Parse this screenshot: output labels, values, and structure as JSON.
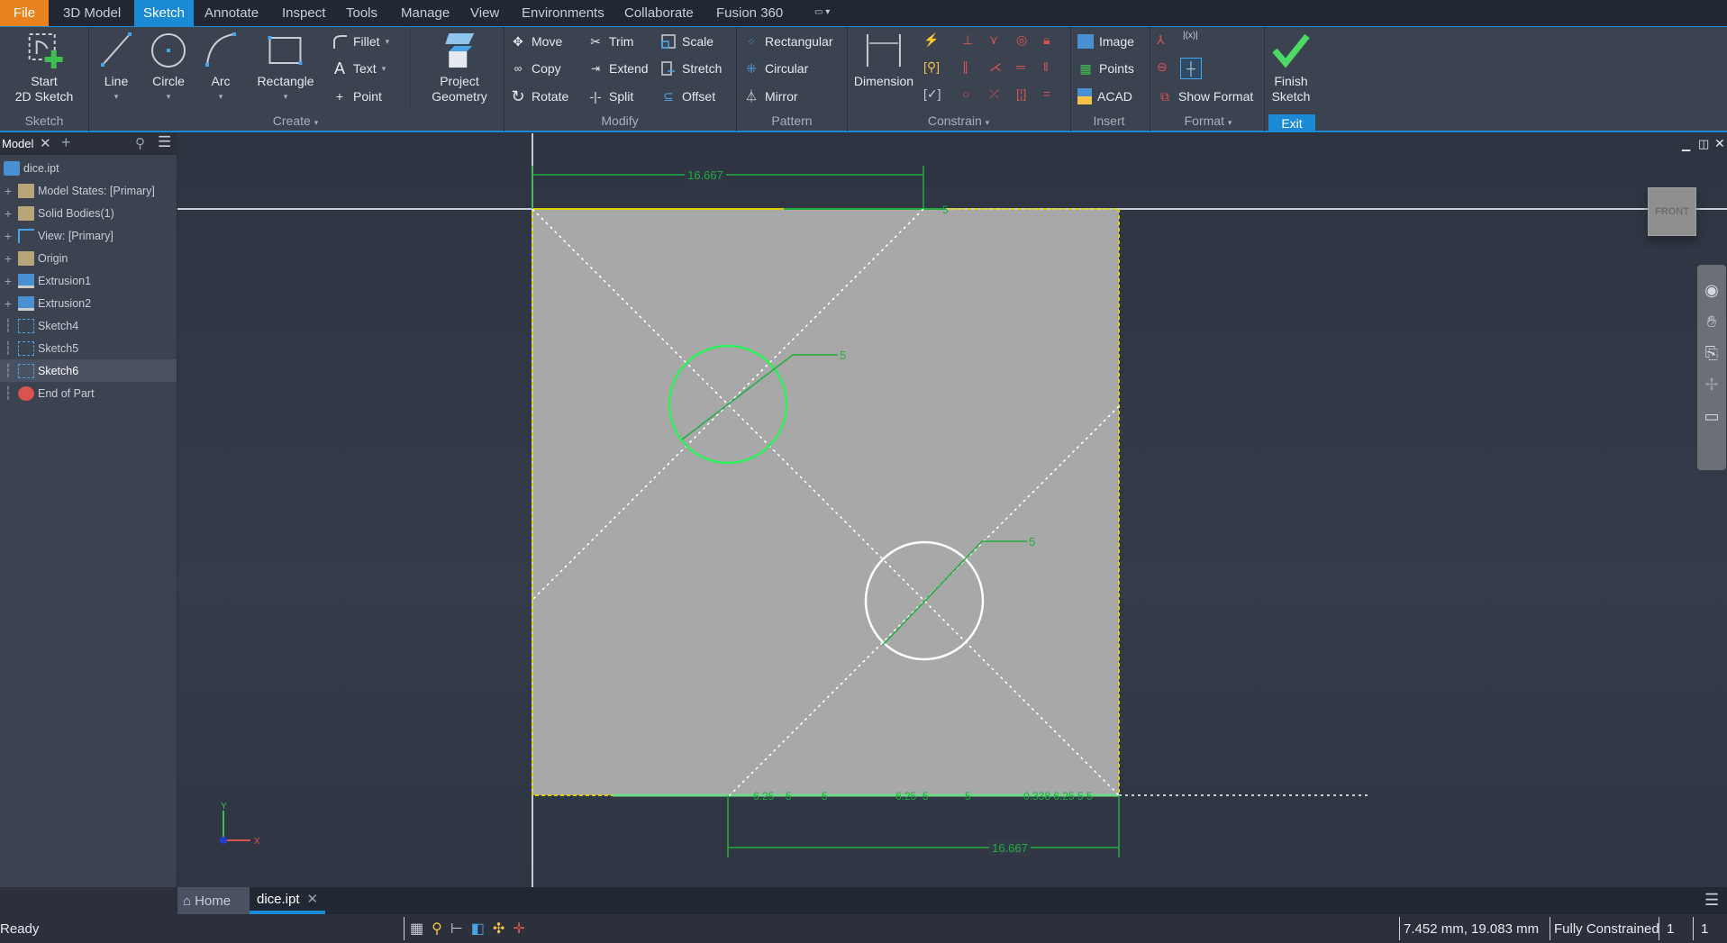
{
  "menu": {
    "tabs": [
      "File",
      "3D Model",
      "Sketch",
      "Annotate",
      "Inspect",
      "Tools",
      "Manage",
      "View",
      "Environments",
      "Collaborate",
      "Fusion 360"
    ],
    "active": "Sketch"
  },
  "ribbon": {
    "sketch_panel": {
      "start_label_1": "Start",
      "start_label_2": "2D Sketch",
      "label": "Sketch"
    },
    "create_panel": {
      "line": "Line",
      "circle": "Circle",
      "arc": "Arc",
      "rectangle": "Rectangle",
      "fillet": "Fillet",
      "text": "Text",
      "point": "Point",
      "project_1": "Project",
      "project_2": "Geometry",
      "label": "Create"
    },
    "modify_panel": {
      "move": "Move",
      "copy": "Copy",
      "rotate": "Rotate",
      "trim": "Trim",
      "extend": "Extend",
      "split": "Split",
      "scale": "Scale",
      "stretch": "Stretch",
      "offset": "Offset",
      "label": "Modify"
    },
    "pattern_panel": {
      "rectangular": "Rectangular",
      "circular": "Circular",
      "mirror": "Mirror",
      "label": "Pattern"
    },
    "constrain_panel": {
      "dimension": "Dimension",
      "label": "Constrain"
    },
    "insert_panel": {
      "image": "Image",
      "points": "Points",
      "acad": "ACAD",
      "label": "Insert"
    },
    "format_panel": {
      "show_format": "Show Format",
      "label": "Format"
    },
    "exit_panel": {
      "finish_1": "Finish",
      "finish_2": "Sketch",
      "label": "Exit"
    }
  },
  "browser": {
    "tab": "Model",
    "items": [
      {
        "label": "dice.ipt",
        "icon": "part-icon"
      },
      {
        "label": "Model States: [Primary]",
        "icon": "folder-icon"
      },
      {
        "label": "Solid Bodies(1)",
        "icon": "folder-body-icon"
      },
      {
        "label": "View: [Primary]",
        "icon": "view-icon"
      },
      {
        "label": "Origin",
        "icon": "folder-icon"
      },
      {
        "label": "Extrusion1",
        "icon": "extrusion-icon"
      },
      {
        "label": "Extrusion2",
        "icon": "extrusion-icon"
      },
      {
        "label": "Sketch4",
        "icon": "sketch-icon"
      },
      {
        "label": "Sketch5",
        "icon": "sketch-icon"
      },
      {
        "label": "Sketch6",
        "icon": "sketch-icon",
        "selected": true
      },
      {
        "label": "End of Part",
        "icon": "end-of-part-icon"
      }
    ]
  },
  "sketch": {
    "dims": {
      "top_width": "16.667",
      "bottom_width": "16.667",
      "circle1_dia": "5",
      "circle2_dia": "5",
      "top_edge": "5",
      "bottom_labels": [
        "6.25",
        "5",
        "5",
        "6.25",
        "5",
        "5",
        "0.338 6.25",
        "5 5"
      ]
    },
    "viewcube": "FRONT",
    "axes": {
      "x": "X",
      "y": "Y"
    },
    "colors": {
      "constraint": "#1fae3c",
      "active_circle": "#2ef05a",
      "sheet": "#a8a8a8",
      "accent": "#1a8ad4"
    }
  },
  "doctabs": {
    "home": "Home",
    "doc": "dice.ipt"
  },
  "status": {
    "text": "Ready",
    "coords": "7.452 mm, 19.083 mm",
    "constraint": "Fully Constrained",
    "count1": "1",
    "count2": "1"
  }
}
